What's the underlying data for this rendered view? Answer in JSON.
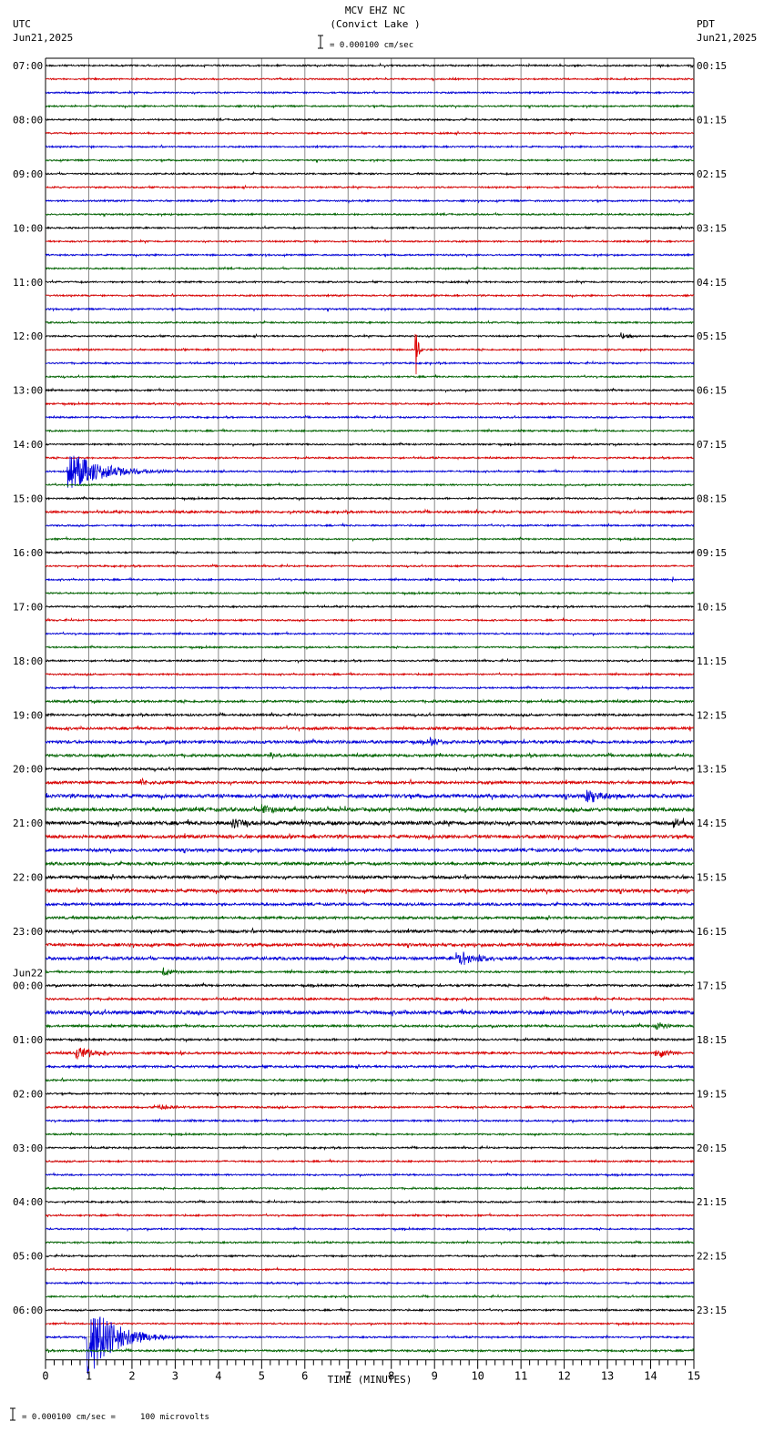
{
  "chart_data": {
    "type": "line",
    "title": "MCV EHZ NC",
    "subtitle": "(Convict Lake )",
    "scale_label": "= 0.000100 cm/sec",
    "left_timezone": "UTC",
    "left_date": "Jun21,2025",
    "right_timezone": "PDT",
    "right_date": "Jun21,2025",
    "left_date_change": "Jun22",
    "left_date_change_before_hour": "00:00",
    "xlabel": "TIME (MINUTES)",
    "xlim": [
      0,
      15
    ],
    "x_ticks": [
      "0",
      "1",
      "2",
      "3",
      "4",
      "5",
      "6",
      "7",
      "8",
      "9",
      "10",
      "11",
      "12",
      "13",
      "14",
      "15"
    ],
    "grid": true,
    "footer": "= 0.000100 cm/sec =     100 microvolts",
    "trace_colors": [
      "#000000",
      "#dd0000",
      "#0000dd",
      "#006600"
    ],
    "traces_per_hour": 4,
    "left_hour_labels": [
      "07:00",
      "08:00",
      "09:00",
      "10:00",
      "11:00",
      "12:00",
      "13:00",
      "14:00",
      "15:00",
      "16:00",
      "17:00",
      "18:00",
      "19:00",
      "20:00",
      "21:00",
      "22:00",
      "23:00",
      "00:00",
      "01:00",
      "02:00",
      "03:00",
      "04:00",
      "05:00",
      "06:00"
    ],
    "right_hour_labels": [
      "00:15",
      "01:15",
      "02:15",
      "03:15",
      "04:15",
      "05:15",
      "06:15",
      "07:15",
      "08:15",
      "09:15",
      "10:15",
      "11:15",
      "12:15",
      "13:15",
      "14:15",
      "15:15",
      "16:15",
      "17:15",
      "18:15",
      "19:15",
      "20:15",
      "21:15",
      "22:15",
      "23:15"
    ],
    "noise_level": [
      1,
      1,
      1,
      1,
      1,
      1,
      1,
      1,
      1,
      1,
      1,
      1,
      1,
      1,
      1,
      1,
      1,
      1,
      1,
      1,
      1,
      1,
      1,
      1,
      1,
      1,
      1,
      1,
      1,
      1,
      1,
      1,
      1,
      1.4,
      1,
      1,
      1,
      1,
      1,
      1,
      1,
      1,
      1,
      1,
      1,
      1,
      1,
      1.4,
      1.3,
      1.6,
      1.8,
      1.6,
      1.5,
      1.7,
      2.2,
      2.2,
      2.2,
      2.0,
      1.8,
      1.8,
      1.8,
      2.0,
      1.6,
      1.5,
      1.7,
      1.8,
      1.8,
      1.2,
      1.3,
      1.3,
      2.2,
      1.4,
      1.2,
      1.4,
      1.4,
      1.2,
      1,
      1.2,
      1.1,
      1,
      1,
      1,
      1,
      1,
      1,
      1,
      1,
      1,
      1,
      1,
      1,
      1,
      1,
      1,
      1,
      1.2
    ],
    "events": [
      {
        "trace": 20,
        "minute": 13.3,
        "amplitude": 4,
        "coda_minutes": 0.6
      },
      {
        "trace": 21,
        "minute": 8.55,
        "amplitude": 55,
        "coda_minutes": 0.1
      },
      {
        "trace": 30,
        "minute": 0.5,
        "amplitude": 24,
        "coda_minutes": 1.6
      },
      {
        "trace": 38,
        "minute": 14.5,
        "amplitude": 7,
        "coda_minutes": 0.05
      },
      {
        "trace": 49,
        "minute": 14.9,
        "amplitude": 5,
        "coda_minutes": 0.1
      },
      {
        "trace": 50,
        "minute": 8.9,
        "amplitude": 6,
        "coda_minutes": 0.4
      },
      {
        "trace": 51,
        "minute": 5.2,
        "amplitude": 5,
        "coda_minutes": 0.3
      },
      {
        "trace": 53,
        "minute": 2.2,
        "amplitude": 4,
        "coda_minutes": 0.5
      },
      {
        "trace": 54,
        "minute": 12.5,
        "amplitude": 8,
        "coda_minutes": 1.0
      },
      {
        "trace": 55,
        "minute": 5.0,
        "amplitude": 7,
        "coda_minutes": 0.6
      },
      {
        "trace": 56,
        "minute": 4.3,
        "amplitude": 6,
        "coda_minutes": 1.0
      },
      {
        "trace": 56,
        "minute": 14.5,
        "amplitude": 6,
        "coda_minutes": 0.5
      },
      {
        "trace": 66,
        "minute": 9.5,
        "amplitude": 9,
        "coda_minutes": 1.0
      },
      {
        "trace": 67,
        "minute": 2.7,
        "amplitude": 6,
        "coda_minutes": 0.5
      },
      {
        "trace": 71,
        "minute": 14.1,
        "amplitude": 6,
        "coda_minutes": 0.4
      },
      {
        "trace": 73,
        "minute": 0.7,
        "amplitude": 8,
        "coda_minutes": 1.0
      },
      {
        "trace": 73,
        "minute": 14.1,
        "amplitude": 9,
        "coda_minutes": 0.6
      },
      {
        "trace": 77,
        "minute": 2.6,
        "amplitude": 4,
        "coda_minutes": 0.6
      },
      {
        "trace": 94,
        "minute": 0.95,
        "amplitude": 48,
        "coda_minutes": 1.3
      }
    ]
  }
}
